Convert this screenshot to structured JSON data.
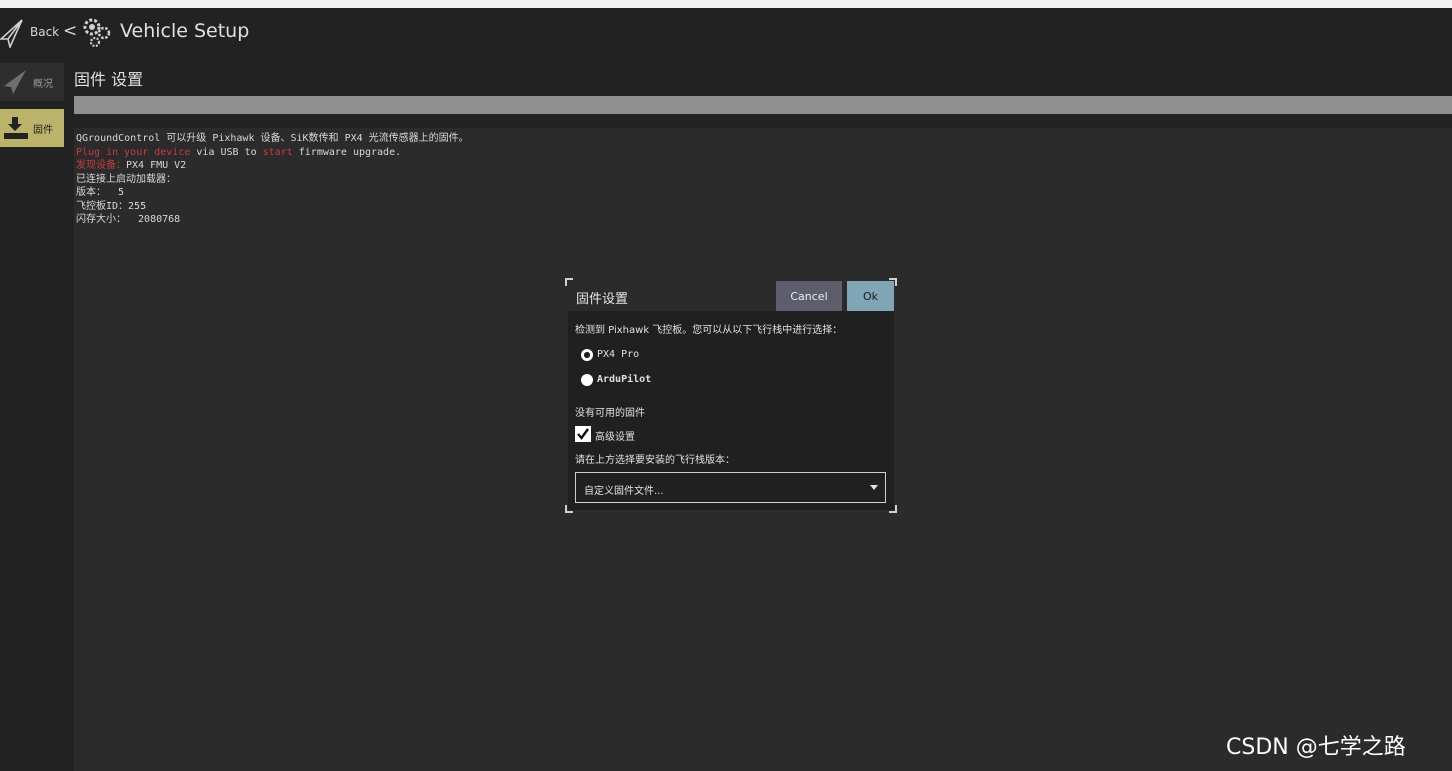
{
  "header": {
    "back_label": "Back",
    "separator": "<",
    "title": "Vehicle Setup"
  },
  "sidebar": {
    "items": [
      {
        "label": "概况",
        "icon": "paper-plane-icon"
      },
      {
        "label": "固件",
        "icon": "download-icon"
      }
    ]
  },
  "page": {
    "title": "固件 设置"
  },
  "log": {
    "line1": "QGroundControl 可以升级 Pixhawk 设备、SiK数传和 PX4 光流传感器上的固件。",
    "line2": {
      "plug": "Plug in your device",
      "via": " via USB to ",
      "start": "start",
      "rest": " firmware upgrade."
    },
    "line3": {
      "label": "发现设备：",
      "value": "PX4 FMU V2"
    },
    "line4": "已连接上启动加载器：",
    "line5": "版本：  5",
    "line6": "飞控板ID：255",
    "line7": "闪存大小：  2080768"
  },
  "dialog": {
    "title": "固件设置",
    "cancel_label": "Cancel",
    "ok_label": "Ok",
    "detected_text": "检测到 Pixhawk 飞控板。您可以从以下飞行栈中进行选择：",
    "options": [
      {
        "label": "PX4 Pro",
        "selected": true
      },
      {
        "label": "ArduPilot",
        "selected": false
      }
    ],
    "no_firmware_text": "没有可用的固件",
    "advanced_label": "高级设置",
    "advanced_checked": true,
    "select_prompt": "请在上方选择要安装的飞行栈版本：",
    "combo_value": "自定义固件文件..."
  },
  "watermark": "CSDN @七学之路",
  "colors": {
    "accent": "#bcb36b",
    "error": "#c83a3a",
    "ok_button": "#7fa5b7",
    "cancel_button": "#5d5d6c"
  }
}
